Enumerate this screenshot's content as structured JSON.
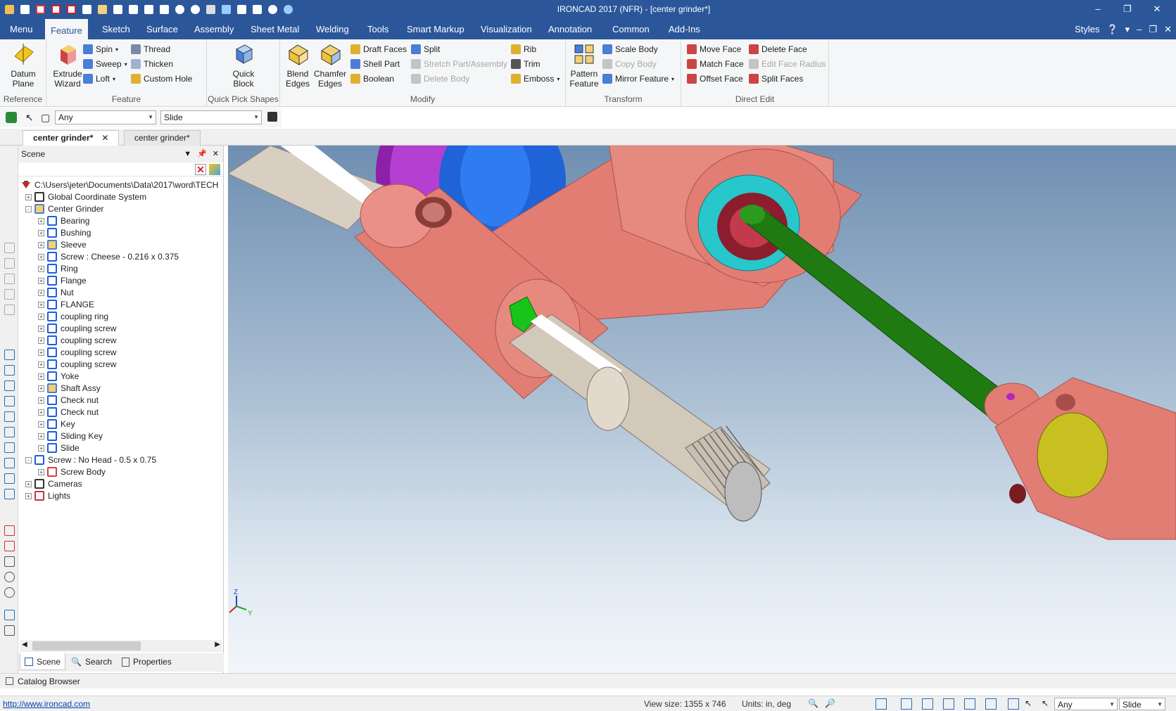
{
  "window": {
    "title": "IRONCAD 2017 (NFR) - [center grinder*]"
  },
  "colors": {
    "ribbon_blue": "#2b579a",
    "part_salmon": "#e07b72",
    "shaft_green": "#1f7a12",
    "ring_cyan": "#27c7cc",
    "accent_blue": "#1e6fc4"
  },
  "tabs": [
    "Menu",
    "Feature",
    "Sketch",
    "Surface",
    "Assembly",
    "Sheet Metal",
    "Welding",
    "Tools",
    "Smart Markup",
    "Visualization",
    "Annotation",
    "Common",
    "Add-Ins"
  ],
  "active_tab": "Feature",
  "styles_label": "Styles",
  "ribbon": {
    "reference": {
      "label": "Reference",
      "datum_plane": "Datum\nPlane"
    },
    "feature": {
      "label": "Feature",
      "extrude_wizard": "Extrude\nWizard",
      "spin": "Spin",
      "sweep": "Sweep",
      "loft": "Loft",
      "thread": "Thread",
      "thicken": "Thicken",
      "custom_hole": "Custom Hole"
    },
    "quick_pick": {
      "label": "Quick Pick Shapes",
      "quick_block": "Quick\nBlock"
    },
    "modify": {
      "label": "Modify",
      "blend_edges": "Blend\nEdges",
      "chamfer_edges": "Chamfer\nEdges",
      "draft_faces": "Draft Faces",
      "shell_part": "Shell Part",
      "boolean": "Boolean",
      "split": "Split",
      "stretch": "Stretch Part/Assembly",
      "delete_body": "Delete Body",
      "rib": "Rib",
      "trim": "Trim",
      "emboss": "Emboss"
    },
    "transform": {
      "label": "Transform",
      "pattern_feature": "Pattern\nFeature",
      "scale_body": "Scale Body",
      "copy_body": "Copy Body",
      "mirror_feature": "Mirror Feature"
    },
    "direct_edit": {
      "label": "Direct Edit",
      "move_face": "Move Face",
      "match_face": "Match Face",
      "offset_face": "Offset Face",
      "delete_face": "Delete Face",
      "edit_face_radius": "Edit Face Radius",
      "split_faces": "Split Faces"
    }
  },
  "selection": {
    "filter": "Any",
    "mode": "Slide"
  },
  "doc_tabs": [
    "center grinder*",
    "center grinder*"
  ],
  "scene_panel": {
    "title": "Scene",
    "root": "C:\\Users\\jeter\\Documents\\Data\\2017\\word\\TECH",
    "items": [
      {
        "label": "Global Coordinate System",
        "level": 1,
        "icon": "axis-icon",
        "exp": "+"
      },
      {
        "label": "Center Grinder",
        "level": 1,
        "icon": "assembly-icon",
        "exp": "-"
      },
      {
        "label": "Bearing",
        "level": 2,
        "icon": "part-icon",
        "exp": "+"
      },
      {
        "label": "Bushing",
        "level": 2,
        "icon": "part-icon",
        "exp": "+"
      },
      {
        "label": "Sleeve",
        "level": 2,
        "icon": "assembly-icon",
        "exp": "+"
      },
      {
        "label": "Screw : Cheese - 0.216 x 0.375",
        "level": 2,
        "icon": "part-icon",
        "exp": "+"
      },
      {
        "label": "Ring",
        "level": 2,
        "icon": "part-icon",
        "exp": "+"
      },
      {
        "label": "Flange",
        "level": 2,
        "icon": "part-icon",
        "exp": "+"
      },
      {
        "label": "Nut",
        "level": 2,
        "icon": "part-icon",
        "exp": "+"
      },
      {
        "label": "FLANGE",
        "level": 2,
        "icon": "part-icon",
        "exp": "+"
      },
      {
        "label": "coupling ring",
        "level": 2,
        "icon": "part-icon",
        "exp": "+"
      },
      {
        "label": "coupling screw",
        "level": 2,
        "icon": "part-icon",
        "exp": "+"
      },
      {
        "label": "coupling screw",
        "level": 2,
        "icon": "part-icon",
        "exp": "+"
      },
      {
        "label": "coupling screw",
        "level": 2,
        "icon": "part-icon",
        "exp": "+"
      },
      {
        "label": "coupling screw",
        "level": 2,
        "icon": "part-icon",
        "exp": "+"
      },
      {
        "label": "Yoke",
        "level": 2,
        "icon": "part-icon",
        "exp": "+"
      },
      {
        "label": "Shaft Assy",
        "level": 2,
        "icon": "assembly-icon",
        "exp": "+"
      },
      {
        "label": "Check nut",
        "level": 2,
        "icon": "part-icon",
        "exp": "+"
      },
      {
        "label": "Check nut",
        "level": 2,
        "icon": "part-icon",
        "exp": "+"
      },
      {
        "label": "Key",
        "level": 2,
        "icon": "part-icon",
        "exp": "+"
      },
      {
        "label": "Sliding Key",
        "level": 2,
        "icon": "part-icon",
        "exp": "+"
      },
      {
        "label": "Slide",
        "level": 2,
        "icon": "part-icon",
        "exp": "+"
      },
      {
        "label": "Screw : No Head - 0.5 x 0.75",
        "level": 1,
        "icon": "part-icon",
        "exp": "-"
      },
      {
        "label": "Screw Body",
        "level": 2,
        "icon": "body-icon",
        "exp": "+"
      },
      {
        "label": "Cameras",
        "level": 1,
        "icon": "camera-icon",
        "exp": "+"
      },
      {
        "label": "Lights",
        "level": 1,
        "icon": "light-icon",
        "exp": "+"
      }
    ],
    "tabs": [
      "Scene",
      "Search",
      "Properties"
    ]
  },
  "axes": {
    "x": "X",
    "y": "Y",
    "z": "Z"
  },
  "catalog_label": "Catalog Browser",
  "status": {
    "url": "http://www.ironcad.com",
    "view_size": "View size: 1355 x  746",
    "units": "Units: in, deg",
    "filter": "Any",
    "mode": "Slide"
  }
}
